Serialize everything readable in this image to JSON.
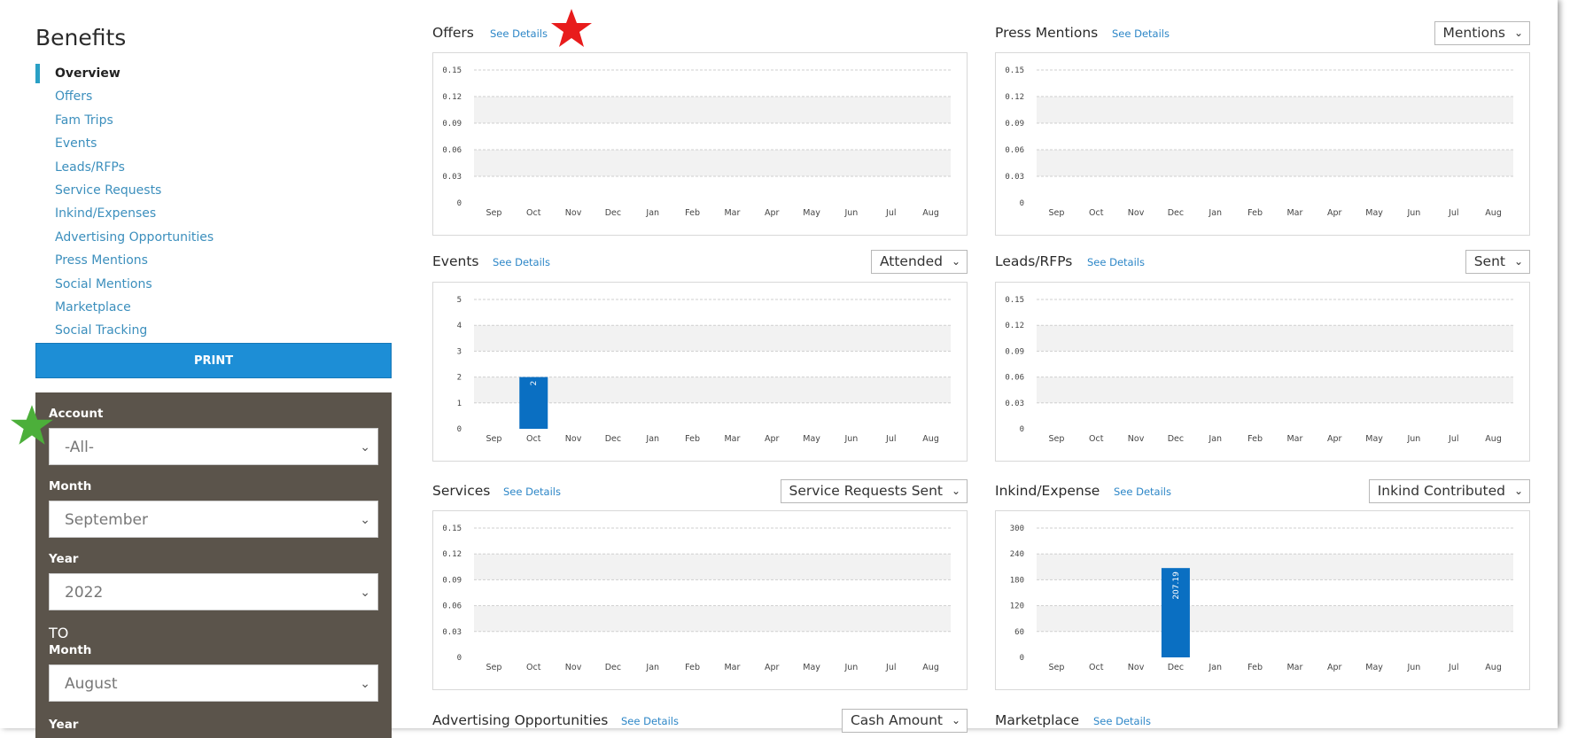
{
  "sidebar": {
    "title": "Benefits",
    "items": [
      {
        "label": "Overview",
        "active": true
      },
      {
        "label": "Offers"
      },
      {
        "label": "Fam Trips"
      },
      {
        "label": "Events"
      },
      {
        "label": "Leads/RFPs"
      },
      {
        "label": "Service Requests"
      },
      {
        "label": "Inkind/Expenses"
      },
      {
        "label": "Advertising Opportunities"
      },
      {
        "label": "Press Mentions"
      },
      {
        "label": "Social Mentions"
      },
      {
        "label": "Marketplace"
      },
      {
        "label": "Social Tracking"
      }
    ],
    "print_label": "PRINT"
  },
  "filters": {
    "account_label": "Account",
    "account_value": "-All-",
    "month_label": "Month",
    "month_value": "September",
    "year_label": "Year",
    "year_value": "2022",
    "to_label": "TO",
    "to_month_label": "Month",
    "to_month_value": "August",
    "to_year_label": "Year"
  },
  "panels": {
    "offers": {
      "title": "Offers",
      "see_details": "See Details"
    },
    "press": {
      "title": "Press Mentions",
      "see_details": "See Details",
      "select": "Mentions"
    },
    "events": {
      "title": "Events",
      "see_details": "See Details",
      "select": "Attended"
    },
    "leads": {
      "title": "Leads/RFPs",
      "see_details": "See Details",
      "select": "Sent"
    },
    "services": {
      "title": "Services",
      "see_details": "See Details",
      "select": "Service Requests Sent"
    },
    "inkind": {
      "title": "Inkind/Expense",
      "see_details": "See Details",
      "select": "Inkind Contributed"
    },
    "advertising": {
      "title": "Advertising Opportunities",
      "see_details": "See Details",
      "select": "Cash Amount"
    },
    "marketplace": {
      "title": "Marketplace",
      "see_details": "See Details"
    }
  },
  "colors": {
    "accent": "#2aa0c5",
    "link": "#3c8fbd",
    "print_button": "#1d8ed6",
    "filter_panel": "#5b544b",
    "bar": "#0a6fc2",
    "star_red": "#e81c1c",
    "star_green": "#4caf3a"
  },
  "icons": [
    "chevron-down-icon",
    "red-star-icon",
    "green-star-icon"
  ],
  "chart_data": [
    {
      "id": "offers",
      "type": "bar",
      "categories": [
        "Sep",
        "Oct",
        "Nov",
        "Dec",
        "Jan",
        "Feb",
        "Mar",
        "Apr",
        "May",
        "Jun",
        "Jul",
        "Aug"
      ],
      "values": [
        0,
        0,
        0,
        0,
        0,
        0,
        0,
        0,
        0,
        0,
        0,
        0
      ],
      "yticks": [
        "0",
        "0.03",
        "0.06",
        "0.09",
        "0.12",
        "0.15"
      ],
      "ylim": [
        0,
        0.15
      ],
      "grid": true
    },
    {
      "id": "press",
      "type": "bar",
      "categories": [
        "Sep",
        "Oct",
        "Nov",
        "Dec",
        "Jan",
        "Feb",
        "Mar",
        "Apr",
        "May",
        "Jun",
        "Jul",
        "Aug"
      ],
      "values": [
        0,
        0,
        0,
        0,
        0,
        0,
        0,
        0,
        0,
        0,
        0,
        0
      ],
      "yticks": [
        "0",
        "0.03",
        "0.06",
        "0.09",
        "0.12",
        "0.15"
      ],
      "ylim": [
        0,
        0.15
      ],
      "grid": true
    },
    {
      "id": "events",
      "type": "bar",
      "categories": [
        "Sep",
        "Oct",
        "Nov",
        "Dec",
        "Jan",
        "Feb",
        "Mar",
        "Apr",
        "May",
        "Jun",
        "Jul",
        "Aug"
      ],
      "values": [
        0,
        2,
        0,
        0,
        0,
        0,
        0,
        0,
        0,
        0,
        0,
        0
      ],
      "data_labels": [
        "",
        "2",
        "",
        "",
        "",
        "",
        "",
        "",
        "",
        "",
        "",
        ""
      ],
      "yticks": [
        "0",
        "1",
        "2",
        "3",
        "4",
        "5"
      ],
      "ylim": [
        0,
        5
      ],
      "grid": true
    },
    {
      "id": "leads",
      "type": "bar",
      "categories": [
        "Sep",
        "Oct",
        "Nov",
        "Dec",
        "Jan",
        "Feb",
        "Mar",
        "Apr",
        "May",
        "Jun",
        "Jul",
        "Aug"
      ],
      "values": [
        0,
        0,
        0,
        0,
        0,
        0,
        0,
        0,
        0,
        0,
        0,
        0
      ],
      "yticks": [
        "0",
        "0.03",
        "0.06",
        "0.09",
        "0.12",
        "0.15"
      ],
      "ylim": [
        0,
        0.15
      ],
      "grid": true
    },
    {
      "id": "services",
      "type": "bar",
      "categories": [
        "Sep",
        "Oct",
        "Nov",
        "Dec",
        "Jan",
        "Feb",
        "Mar",
        "Apr",
        "May",
        "Jun",
        "Jul",
        "Aug"
      ],
      "values": [
        0,
        0,
        0,
        0,
        0,
        0,
        0,
        0,
        0,
        0,
        0,
        0
      ],
      "yticks": [
        "0",
        "0.03",
        "0.06",
        "0.09",
        "0.12",
        "0.15"
      ],
      "ylim": [
        0,
        0.15
      ],
      "grid": true
    },
    {
      "id": "inkind",
      "type": "bar",
      "categories": [
        "Sep",
        "Oct",
        "Nov",
        "Dec",
        "Jan",
        "Feb",
        "Mar",
        "Apr",
        "May",
        "Jun",
        "Jul",
        "Aug"
      ],
      "values": [
        0,
        0,
        0,
        207.19,
        0,
        0,
        0,
        0,
        0,
        0,
        0,
        0
      ],
      "data_labels": [
        "",
        "",
        "",
        "207.19",
        "",
        "",
        "",
        "",
        "",
        "",
        "",
        ""
      ],
      "yticks": [
        "0",
        "60",
        "120",
        "180",
        "240",
        "300"
      ],
      "ylim": [
        0,
        300
      ],
      "grid": true
    }
  ]
}
